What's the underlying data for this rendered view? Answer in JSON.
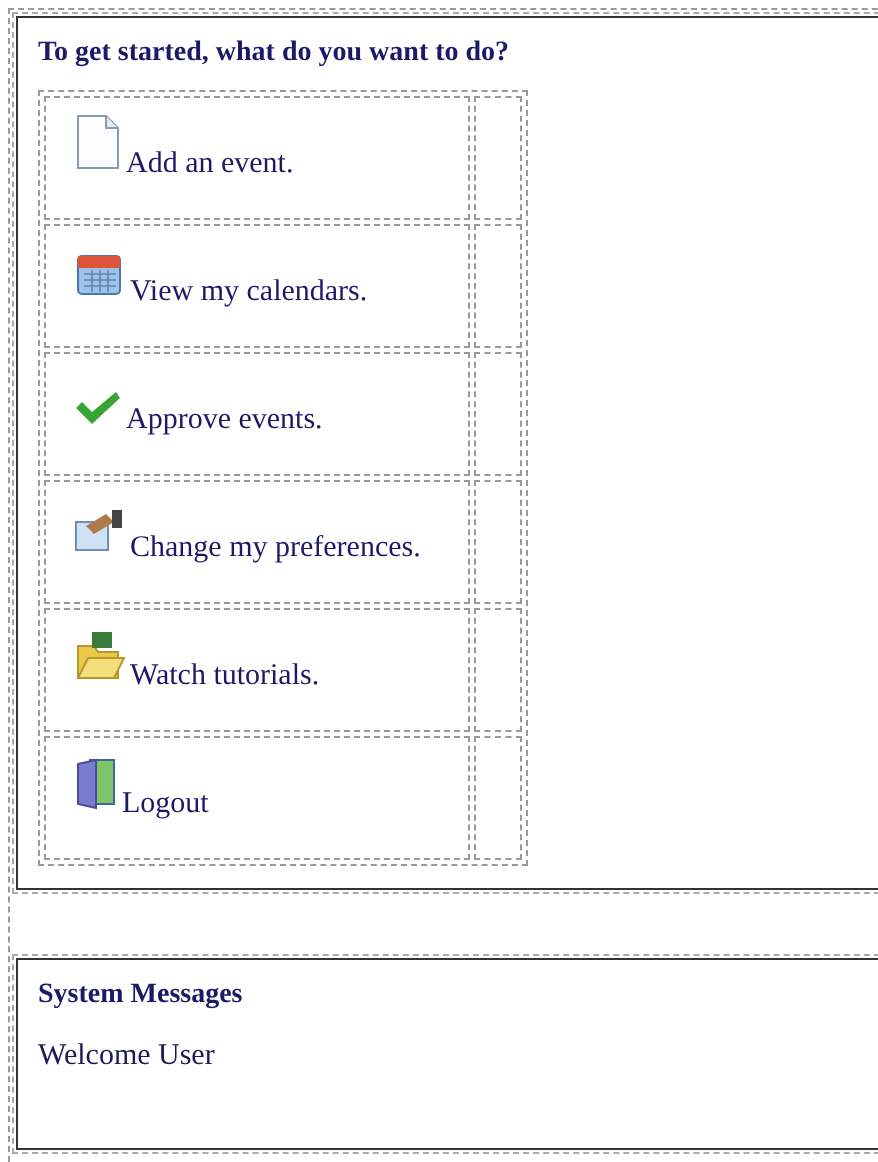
{
  "start_panel": {
    "heading": "To get started, what do you want to do?",
    "actions": [
      {
        "label": "Add an event."
      },
      {
        "label": "View my calendars."
      },
      {
        "label": "Approve events."
      },
      {
        "label": "Change my preferences."
      },
      {
        "label": "Watch tutorials."
      },
      {
        "label": "Logout"
      }
    ]
  },
  "messages_panel": {
    "heading": "System Messages",
    "messages": [
      "Welcome User"
    ]
  }
}
